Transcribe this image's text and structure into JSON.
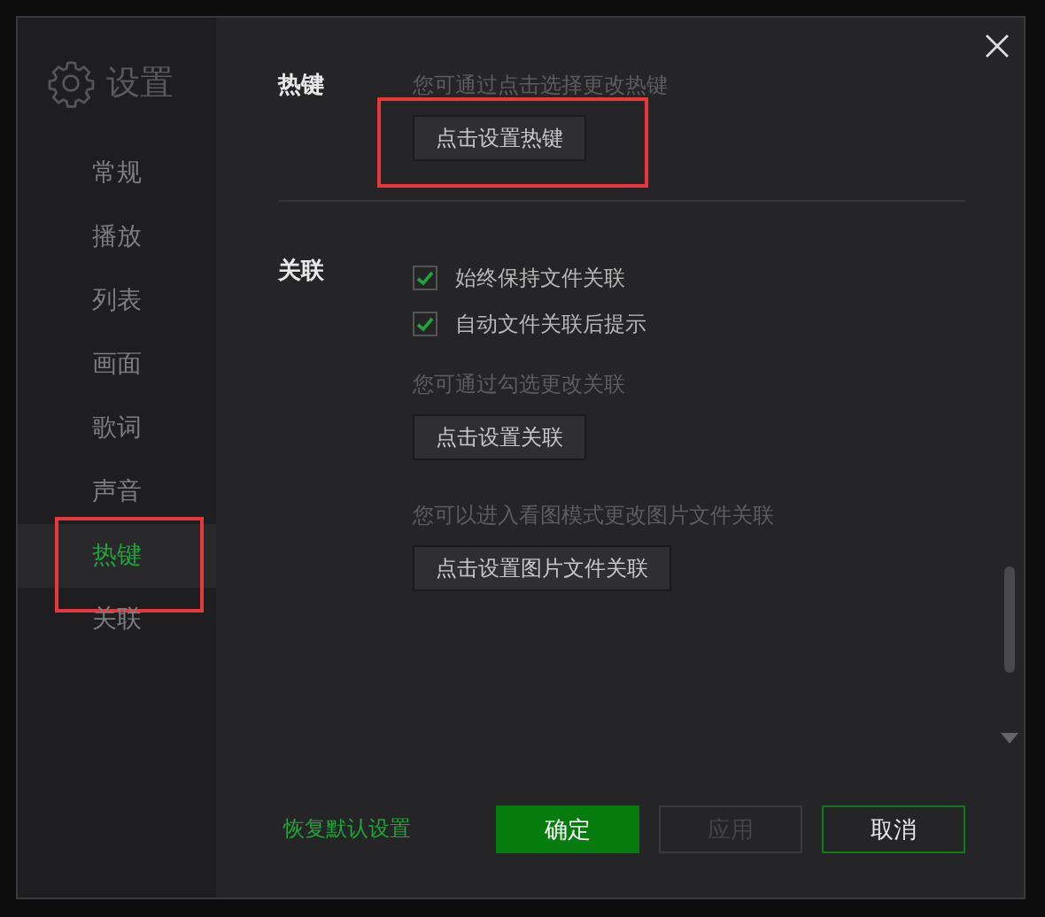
{
  "dialog": {
    "title": "设置"
  },
  "sidebar": {
    "items": [
      {
        "label": "常规",
        "selected": false,
        "highlighted": false
      },
      {
        "label": "播放",
        "selected": false,
        "highlighted": false
      },
      {
        "label": "列表",
        "selected": false,
        "highlighted": false
      },
      {
        "label": "画面",
        "selected": false,
        "highlighted": false
      },
      {
        "label": "歌词",
        "selected": false,
        "highlighted": false
      },
      {
        "label": "声音",
        "selected": false,
        "highlighted": false
      },
      {
        "label": "热键",
        "selected": true,
        "highlighted": true
      },
      {
        "label": "关联",
        "selected": false,
        "highlighted": false
      }
    ]
  },
  "sections": [
    {
      "title": "热键",
      "blocks": [
        {
          "kind": "hint",
          "text": "您可通过点击选择更改热键"
        },
        {
          "kind": "button",
          "label": "点击设置热键",
          "highlighted": true
        }
      ]
    },
    {
      "title": "关联",
      "blocks": [
        {
          "kind": "checkbox",
          "label": "始终保持文件关联",
          "checked": true
        },
        {
          "kind": "checkbox",
          "label": "自动文件关联后提示",
          "checked": true
        },
        {
          "kind": "hint",
          "text": "您可通过勾选更改关联"
        },
        {
          "kind": "button",
          "label": "点击设置关联",
          "highlighted": false
        },
        {
          "kind": "hint",
          "text": "您可以进入看图模式更改图片文件关联"
        },
        {
          "kind": "button",
          "label": "点击设置图片文件关联",
          "highlighted": false
        }
      ]
    }
  ],
  "footer": {
    "reset_link": "恢复默认设置",
    "buttons": [
      {
        "label": "确定",
        "kind": "primary",
        "disabled": false
      },
      {
        "label": "应用",
        "kind": "secondary",
        "disabled": true
      },
      {
        "label": "取消",
        "kind": "secondary",
        "disabled": false
      }
    ]
  }
}
